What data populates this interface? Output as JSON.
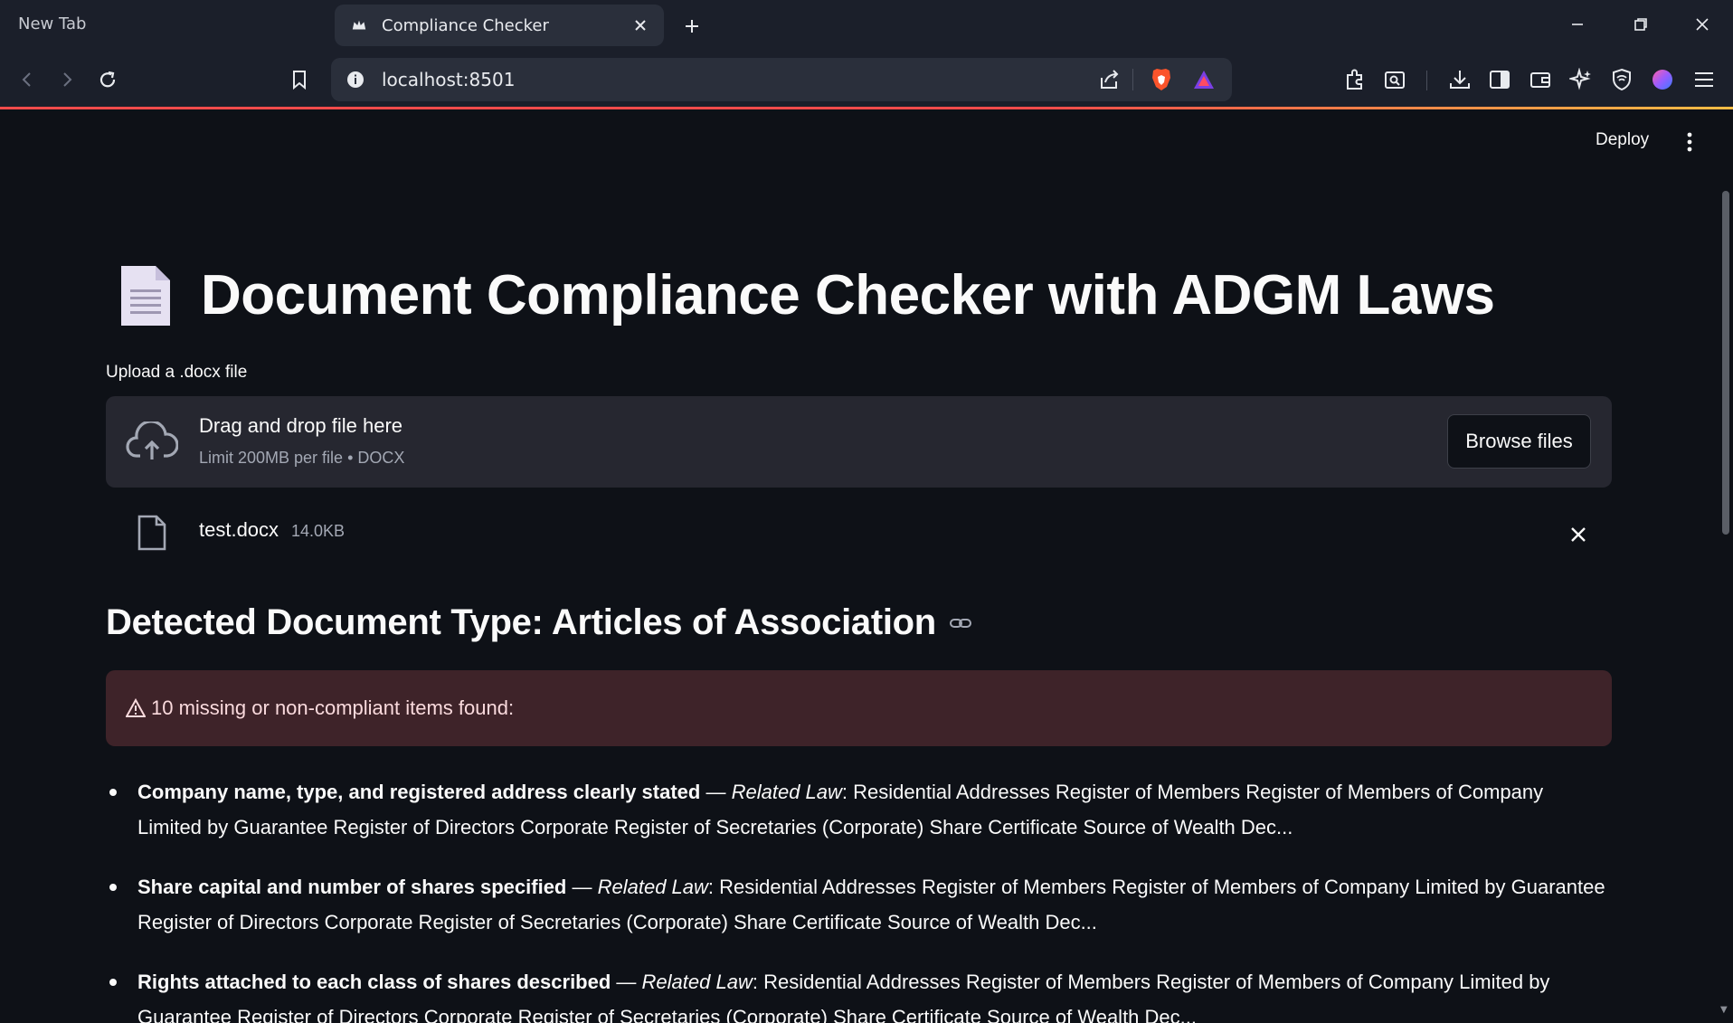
{
  "browser": {
    "tabs": [
      {
        "title": "New Tab",
        "active": false
      },
      {
        "title": "Compliance Checker",
        "active": true
      }
    ],
    "url": "localhost:8501"
  },
  "app": {
    "deploy_label": "Deploy",
    "title": "Document Compliance Checker with ADGM Laws",
    "upload": {
      "label": "Upload a .docx file",
      "drop_text": "Drag and drop file here",
      "limit_text": "Limit 200MB per file • DOCX",
      "browse_label": "Browse files"
    },
    "uploaded_file": {
      "name": "test.docx",
      "size": "14.0KB"
    },
    "detected_heading": "Detected Document Type: Articles of Association",
    "alert_text": "10 missing or non-compliant items found:",
    "items": [
      {
        "title": "Company name, type, and registered address clearly stated",
        "sep": " — ",
        "law_label": "Related Law",
        "law_text": ": Residential Addresses Register of Members Register of Members of Company Limited by Guarantee Register of Directors Corporate Register of Secretaries (Corporate) Share Certificate Source of Wealth Dec..."
      },
      {
        "title": "Share capital and number of shares specified",
        "sep": " — ",
        "law_label": "Related Law",
        "law_text": ": Residential Addresses Register of Members Register of Members of Company Limited by Guarantee Register of Directors Corporate Register of Secretaries (Corporate) Share Certificate Source of Wealth Dec..."
      },
      {
        "title": "Rights attached to each class of shares described",
        "sep": " — ",
        "law_label": "Related Law",
        "law_text": ": Residential Addresses Register of Members Register of Members of Company Limited by Guarantee Register of Directors Corporate Register of Secretaries (Corporate) Share Certificate Source of Wealth Dec..."
      }
    ]
  },
  "colors": {
    "app_bg": "#0e1117",
    "chrome_bg": "#1b1f2a",
    "dropzone_bg": "#262730",
    "alert_bg": "#3e2329",
    "accent": "#ff4b4b"
  }
}
